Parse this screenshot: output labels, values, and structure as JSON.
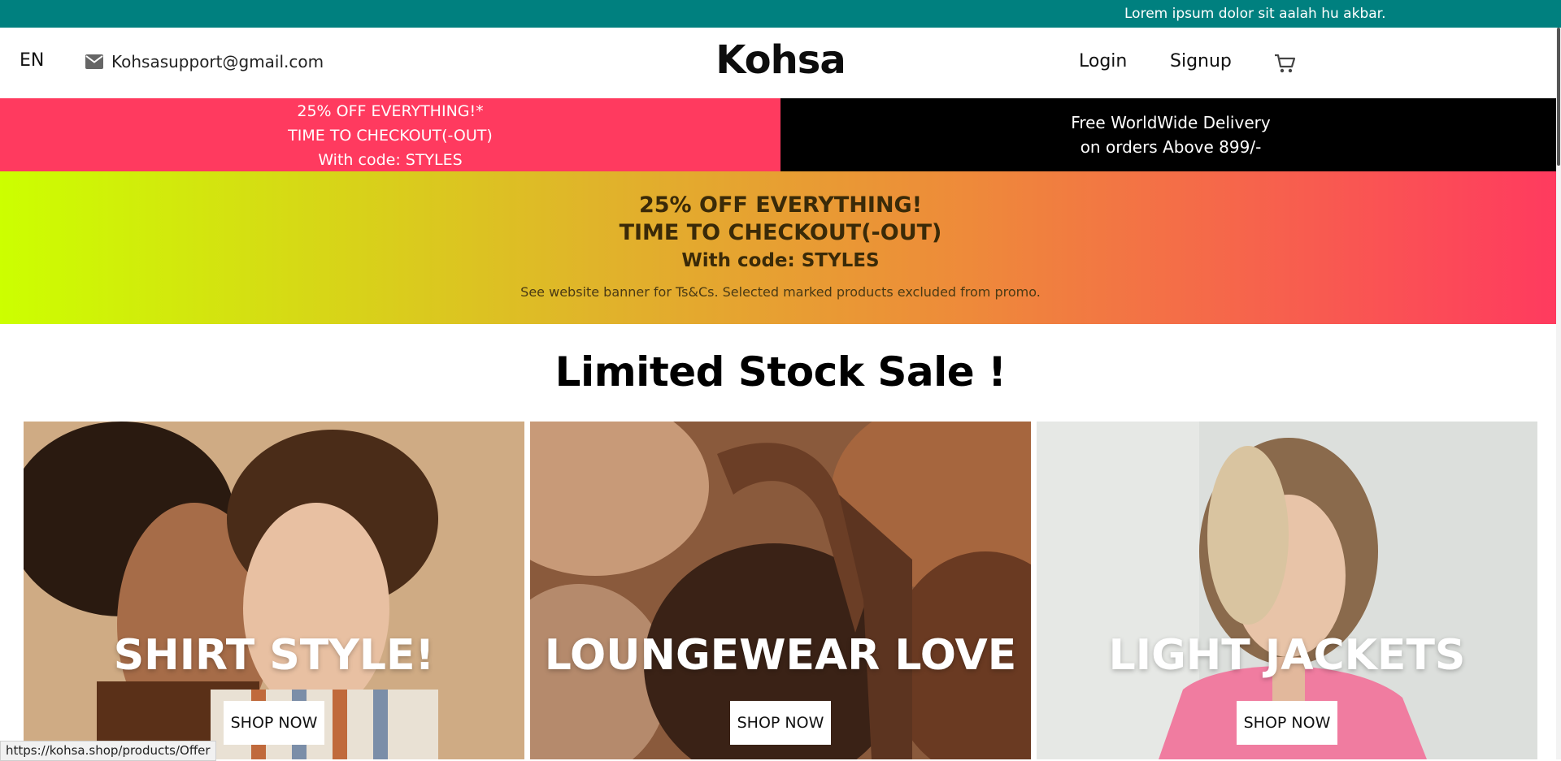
{
  "announcement": {
    "text": "Lorem ipsum dolor sit aalah hu akbar."
  },
  "header": {
    "language": "EN",
    "email": "Kohsasupport@gmail.com",
    "logo": "Kohsa",
    "nav": {
      "login": "Login",
      "signup": "Signup"
    },
    "icons": {
      "mail": "mail-icon",
      "cart": "cart-icon"
    }
  },
  "promo_strip": {
    "left": {
      "line1": "25% OFF EVERYTHING!*",
      "line2": "TIME TO CHECKOUT(-OUT)",
      "line3": "With code: STYLES"
    },
    "right": {
      "line1": "Free WorldWide Delivery",
      "line2": "on orders Above 899/-"
    }
  },
  "gradient_banner": {
    "line1": "25% OFF EVERYTHING!",
    "line2": "TIME TO CHECKOUT(-OUT)",
    "line3": "With code: STYLES",
    "note": "See website banner for Ts&Cs. Selected marked products excluded from promo."
  },
  "sale_section": {
    "title": "Limited Stock Sale !",
    "cards": [
      {
        "title": "SHIRT STYLE!",
        "button": "SHOP NOW"
      },
      {
        "title": "LOUNGEWEAR LOVE",
        "button": "SHOP NOW"
      },
      {
        "title": "LIGHT JACKETS",
        "button": "SHOP NOW"
      }
    ]
  },
  "status_bar": {
    "url": "https://kohsa.shop/products/Offer"
  },
  "colors": {
    "topbar": "#00807f",
    "promo_left": "#ff3a5f",
    "promo_right": "#000000",
    "gradient_start": "#ccff00",
    "gradient_end": "#ff3a5f"
  }
}
